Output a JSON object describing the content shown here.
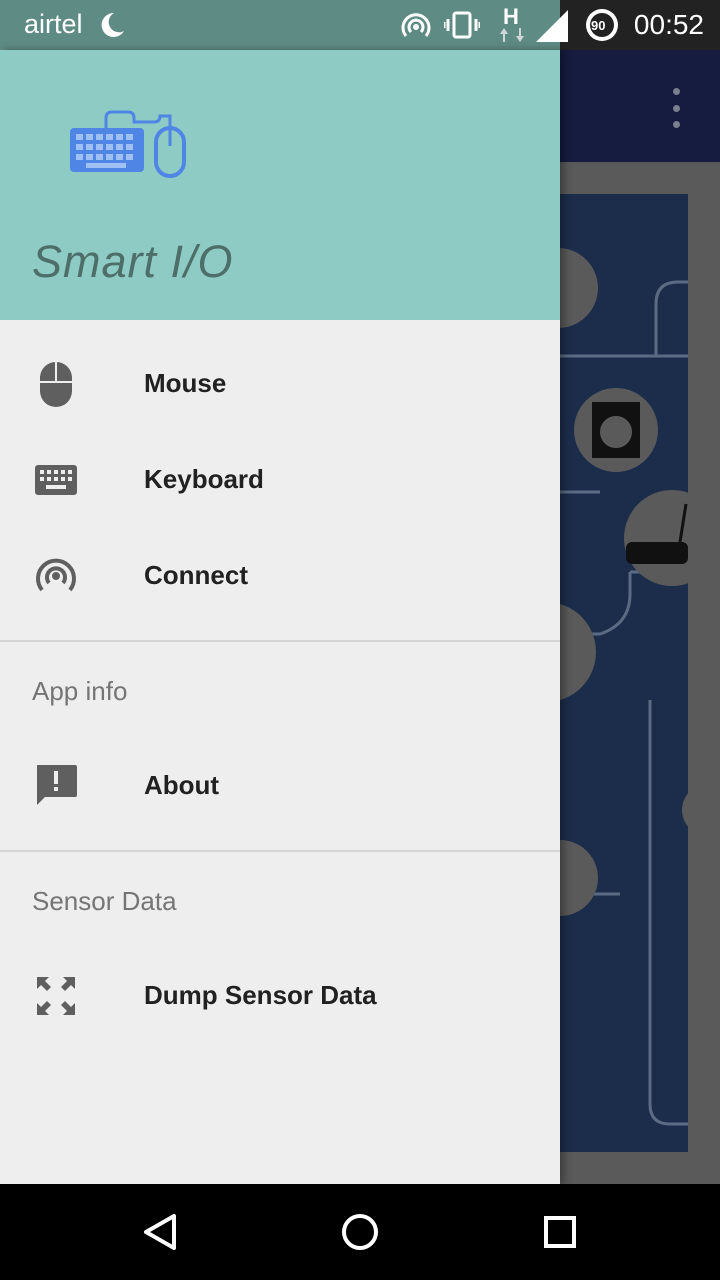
{
  "status_bar": {
    "carrier": "airtel",
    "battery_level": "90",
    "time": "00:52",
    "network_type": "H",
    "icons": [
      "moon-icon",
      "hotspot-icon",
      "vibrate-icon",
      "network-h-icon",
      "signal-icon",
      "battery-icon"
    ]
  },
  "drawer": {
    "app_name": "Smart I/O",
    "logo_icon": "keyboard-mouse-logo-icon",
    "main_items": [
      {
        "label": "Mouse",
        "icon": "mouse-icon"
      },
      {
        "label": "Keyboard",
        "icon": "keyboard-icon"
      },
      {
        "label": "Connect",
        "icon": "wireless-icon"
      }
    ],
    "sections": [
      {
        "title": "App info",
        "items": [
          {
            "label": "About",
            "icon": "feedback-icon"
          }
        ]
      },
      {
        "title": "Sensor Data",
        "items": [
          {
            "label": "Dump Sensor Data",
            "icon": "expand-arrows-icon"
          }
        ]
      }
    ]
  },
  "colors": {
    "header_bg": "#8ecbc4",
    "drawer_bg": "#eeeeee",
    "toolbar_bg": "#151c3f",
    "logo_blue": "#4f86e6"
  },
  "nav_bar": {
    "buttons": [
      "back-icon",
      "home-icon",
      "recents-icon"
    ]
  }
}
